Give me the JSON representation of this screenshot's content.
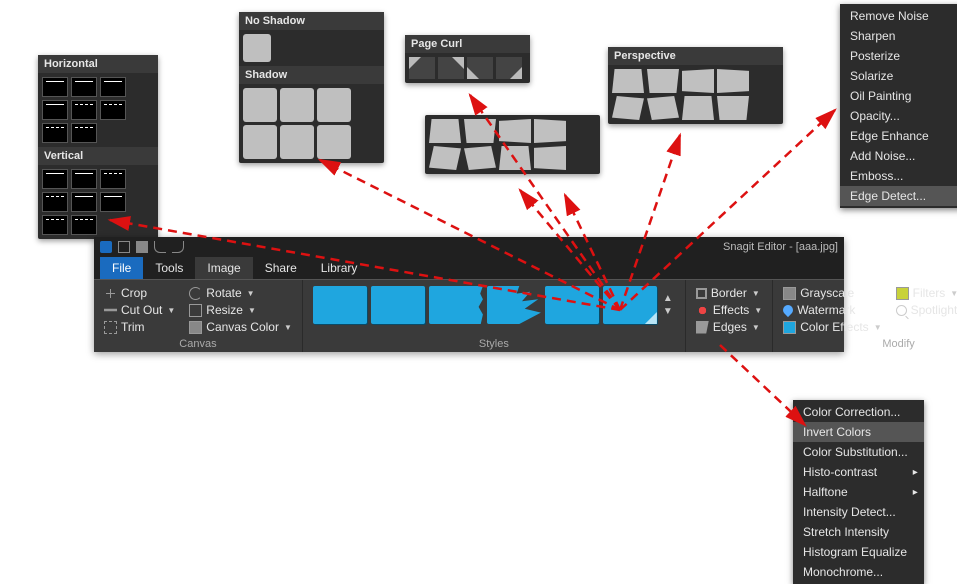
{
  "app": {
    "title": "Snagit Editor - [aaa.jpg]",
    "tabs": {
      "file": "File",
      "tools": "Tools",
      "image": "Image",
      "share": "Share",
      "library": "Library"
    }
  },
  "ribbon": {
    "canvas": {
      "label": "Canvas",
      "crop": "Crop",
      "rotate": "Rotate",
      "cutout": "Cut Out",
      "resize": "Resize",
      "trim": "Trim",
      "canvascolor": "Canvas Color"
    },
    "styles": {
      "label": "Styles"
    },
    "effects_group": {
      "border": "Border",
      "effects": "Effects",
      "edges": "Edges"
    },
    "modify": {
      "label": "Modify",
      "grayscale": "Grayscale",
      "watermark": "Watermark",
      "coloreffects": "Color Effects",
      "filters": "Filters",
      "spotlight": "Spotlight & Magnify"
    }
  },
  "popups": {
    "edges": {
      "horizontal": "Horizontal",
      "vertical": "Vertical"
    },
    "shadow": {
      "none": "No Shadow",
      "title": "Shadow"
    },
    "pagecurl": "Page Curl",
    "perspective": "Perspective"
  },
  "filters_menu": {
    "items": [
      "Remove Noise",
      "Sharpen",
      "Posterize",
      "Solarize",
      "Oil Painting",
      "Opacity...",
      "Edge Enhance",
      "Add Noise...",
      "Emboss...",
      "Edge Detect..."
    ],
    "submenu_flags": [
      true,
      true,
      true,
      true,
      true,
      false,
      false,
      false,
      false,
      false
    ],
    "hover_index": 9
  },
  "coloreffects_menu": {
    "items": [
      "Color Correction...",
      "Invert Colors",
      "Color Substitution...",
      "Histo-contrast",
      "Halftone",
      "Intensity Detect...",
      "Stretch Intensity",
      "Histogram Equalize",
      "Monochrome..."
    ],
    "submenu_flags": [
      false,
      false,
      false,
      true,
      true,
      false,
      false,
      false,
      false
    ],
    "hover_index": 1
  }
}
